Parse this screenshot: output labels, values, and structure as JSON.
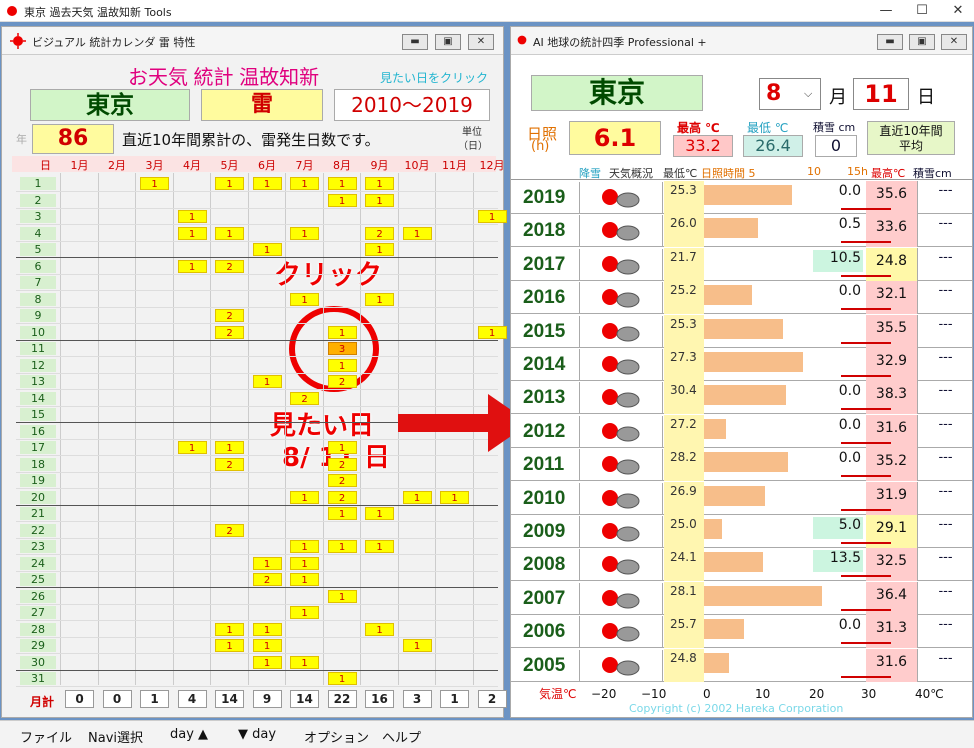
{
  "window_title": "東京  過去天気  温故知新 Tools",
  "menu": [
    "ファイル",
    "Navi選択",
    "day ▲",
    "▼ day",
    "オプション",
    "ヘルプ"
  ],
  "left": {
    "title": "ビジュアル 統計カレンダ  雷 特性",
    "heading": "お天気 統計 温故知新",
    "hint": "見たい日をクリック",
    "city": "東京",
    "element": "雷",
    "period": "2010～2019",
    "year_label": "年",
    "count": "86",
    "desc": "直近10年間累計の、雷発生日数です。",
    "unit1": "単位",
    "unit2": "（日）",
    "day_header": "日",
    "months": [
      "1月",
      "2月",
      "3月",
      "4月",
      "5月",
      "6月",
      "7月",
      "8月",
      "9月",
      "10月",
      "11月",
      "12月"
    ],
    "days": [
      "1",
      "2",
      "3",
      "4",
      "5",
      "6",
      "7",
      "8",
      "9",
      "10",
      "11",
      "12",
      "13",
      "14",
      "15",
      "16",
      "17",
      "18",
      "19",
      "20",
      "21",
      "22",
      "23",
      "24",
      "25",
      "26",
      "27",
      "28",
      "29",
      "30",
      "31"
    ],
    "cells": [
      [
        1,
        3,
        "1"
      ],
      [
        1,
        5,
        "1"
      ],
      [
        1,
        6,
        "1"
      ],
      [
        1,
        7,
        "1"
      ],
      [
        1,
        8,
        "1"
      ],
      [
        1,
        9,
        "1"
      ],
      [
        2,
        8,
        "1"
      ],
      [
        2,
        9,
        "1"
      ],
      [
        3,
        4,
        "1"
      ],
      [
        3,
        12,
        "1"
      ],
      [
        4,
        4,
        "1"
      ],
      [
        4,
        5,
        "1"
      ],
      [
        4,
        7,
        "1"
      ],
      [
        4,
        9,
        "2"
      ],
      [
        4,
        10,
        "1"
      ],
      [
        5,
        6,
        "1"
      ],
      [
        5,
        9,
        "1"
      ],
      [
        6,
        4,
        "1"
      ],
      [
        6,
        5,
        "2"
      ],
      [
        8,
        7,
        "1"
      ],
      [
        8,
        9,
        "1"
      ],
      [
        9,
        5,
        "2"
      ],
      [
        10,
        5,
        "2"
      ],
      [
        10,
        8,
        "1"
      ],
      [
        10,
        12,
        "1"
      ],
      [
        11,
        8,
        "3"
      ],
      [
        12,
        8,
        "1"
      ],
      [
        13,
        6,
        "1"
      ],
      [
        13,
        8,
        "2"
      ],
      [
        14,
        7,
        "2"
      ],
      [
        17,
        4,
        "1"
      ],
      [
        17,
        5,
        "1"
      ],
      [
        17,
        8,
        "1"
      ],
      [
        18,
        5,
        "2"
      ],
      [
        18,
        8,
        "2"
      ],
      [
        19,
        8,
        "2"
      ],
      [
        20,
        7,
        "1"
      ],
      [
        20,
        8,
        "2"
      ],
      [
        20,
        10,
        "1"
      ],
      [
        20,
        11,
        "1"
      ],
      [
        21,
        8,
        "1"
      ],
      [
        21,
        9,
        "1"
      ],
      [
        22,
        5,
        "2"
      ],
      [
        23,
        7,
        "1"
      ],
      [
        23,
        8,
        "1"
      ],
      [
        23,
        9,
        "1"
      ],
      [
        24,
        6,
        "1"
      ],
      [
        24,
        7,
        "1"
      ],
      [
        25,
        6,
        "2"
      ],
      [
        25,
        7,
        "1"
      ],
      [
        26,
        8,
        "1"
      ],
      [
        27,
        7,
        "1"
      ],
      [
        28,
        5,
        "1"
      ],
      [
        28,
        6,
        "1"
      ],
      [
        28,
        9,
        "1"
      ],
      [
        29,
        5,
        "1"
      ],
      [
        29,
        6,
        "1"
      ],
      [
        29,
        10,
        "1"
      ],
      [
        30,
        6,
        "1"
      ],
      [
        30,
        7,
        "1"
      ],
      [
        31,
        8,
        "1"
      ]
    ],
    "total_label": "月計",
    "totals": [
      "0",
      "0",
      "1",
      "4",
      "14",
      "9",
      "14",
      "22",
      "16",
      "3",
      "1",
      "2"
    ],
    "annot_click": "クリック",
    "annot_want1": "見たい日",
    "annot_want2": "8/ 11 日"
  },
  "right": {
    "title": "AI  地球の統計四季 Professional +",
    "city": "東京",
    "month": "8",
    "month_label": "月",
    "day": "11",
    "day_label": "日",
    "sun_label1": "日照",
    "sun_label2": "(h)",
    "sun_value": "6.1",
    "max_label": "最高 ℃",
    "max_value": "33.2",
    "min_label": "最低 ℃",
    "min_value": "26.4",
    "snow_label": "積雪 cm",
    "snow_value": "0",
    "avg_label1": "直近10年間",
    "avg_label2": "平均",
    "col_headers": [
      "降雪",
      "天気概況",
      "最低℃",
      "日照時間 5",
      "10",
      "15h",
      "最高℃",
      "積雪cm"
    ],
    "rows": [
      {
        "year": "2019",
        "min": "25.3",
        "sun": 17.5,
        "precip": "0.0",
        "max": "35.6",
        "snow": "---"
      },
      {
        "year": "2018",
        "min": "26.0",
        "sun": 10.8,
        "precip": "0.5",
        "max": "33.6",
        "snow": "---"
      },
      {
        "year": "2017",
        "min": "21.7",
        "sun": 0,
        "precip": "10.5",
        "max": "24.8",
        "snow": "---"
      },
      {
        "year": "2016",
        "min": "25.2",
        "sun": 9.6,
        "precip": "0.0",
        "max": "32.1",
        "snow": "---"
      },
      {
        "year": "2015",
        "min": "25.3",
        "sun": 15.8,
        "precip": "",
        "max": "35.5",
        "snow": "---"
      },
      {
        "year": "2014",
        "min": "27.3",
        "sun": 19.8,
        "precip": "",
        "max": "32.9",
        "snow": "---"
      },
      {
        "year": "2013",
        "min": "30.4",
        "sun": 16.3,
        "precip": "0.0",
        "max": "38.3",
        "snow": "---"
      },
      {
        "year": "2012",
        "min": "27.2",
        "sun": 4.4,
        "precip": "0.0",
        "max": "31.6",
        "snow": "---"
      },
      {
        "year": "2011",
        "min": "28.2",
        "sun": 16.7,
        "precip": "0.0",
        "max": "35.2",
        "snow": "---"
      },
      {
        "year": "2010",
        "min": "26.9",
        "sun": 12.2,
        "precip": "",
        "max": "31.9",
        "snow": "---"
      },
      {
        "year": "2009",
        "min": "25.0",
        "sun": 3.5,
        "precip": "5.0",
        "max": "29.1",
        "snow": "---"
      },
      {
        "year": "2008",
        "min": "24.1",
        "sun": 11.8,
        "precip": "13.5",
        "max": "32.5",
        "snow": "---"
      },
      {
        "year": "2007",
        "min": "28.1",
        "sun": 23.5,
        "precip": "",
        "max": "36.4",
        "snow": "---"
      },
      {
        "year": "2006",
        "min": "25.7",
        "sun": 7.9,
        "precip": "0.0",
        "max": "31.3",
        "snow": "---"
      },
      {
        "year": "2005",
        "min": "24.8",
        "sun": 5.0,
        "precip": "",
        "max": "31.6",
        "snow": "---"
      }
    ],
    "axis_label": "気温℃",
    "axis_ticks": [
      "−20",
      "−10",
      "0",
      "10",
      "20",
      "30",
      "40℃"
    ],
    "copyright": "Copyright (c) 2002 Hareka Corporation"
  }
}
